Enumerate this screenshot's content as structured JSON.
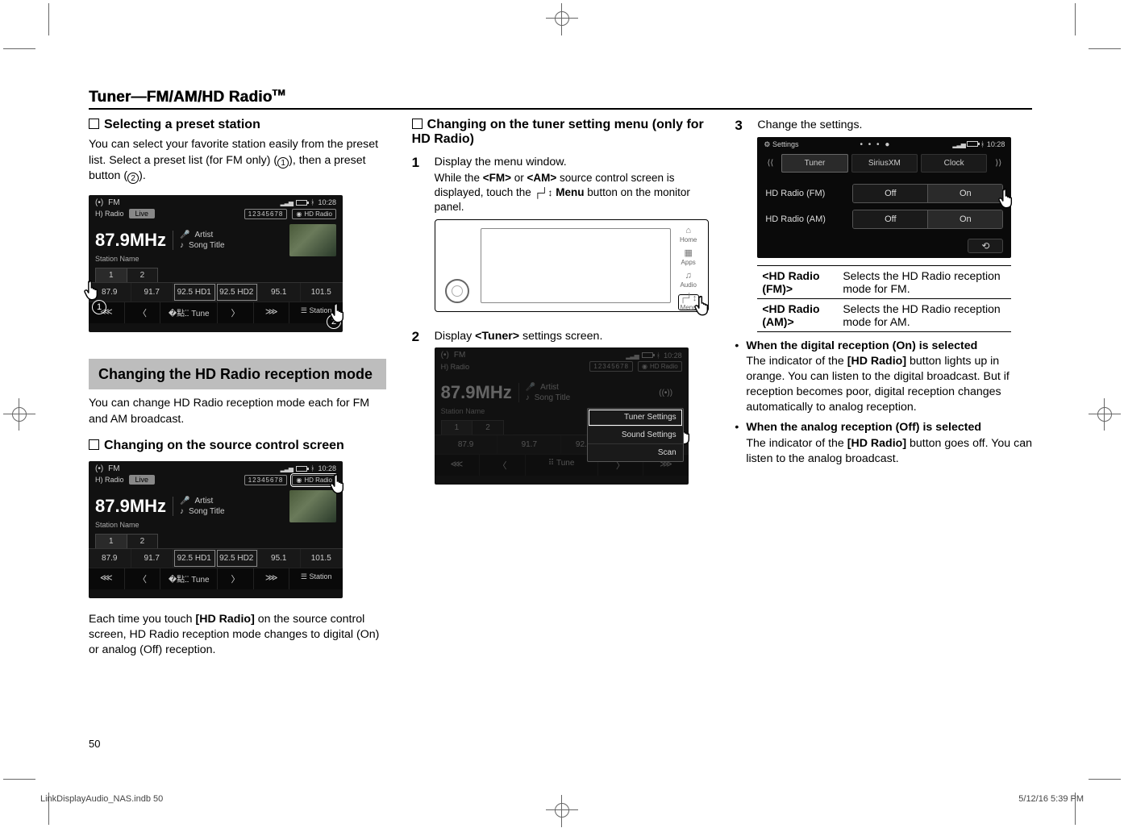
{
  "section_title_prefix": "Tuner—FM/AM/HD Radio",
  "section_title_suffix": "TM",
  "col1": {
    "h_preset": "Selecting a preset station",
    "p_preset_1": "You can select your favorite station easily from the preset list. Select a preset list (for FM only) (",
    "p_preset_circ1": "1",
    "p_preset_mid": "), then a preset button (",
    "p_preset_circ2": "2",
    "p_preset_end": ").",
    "graybox": "Changing the HD Radio reception mode",
    "p_change": "You can change HD Radio reception mode each for FM and AM broadcast.",
    "h_source": "Changing on the source control screen",
    "p_source": "Each time you touch [HD Radio] on the source control screen, HD Radio reception mode changes to digital (On) or analog (Off) reception.",
    "p_source_pre": "Each time you touch ",
    "p_source_bold": "[HD Radio]",
    "p_source_post": " on the source control screen, HD Radio reception mode changes to digital (On) or analog (Off) reception."
  },
  "col2": {
    "h_tuner": "Changing on the tuner setting menu (only for HD Radio)",
    "step1_title": "Display the menu window.",
    "step1_body_pre": "While the ",
    "step1_fm": "<FM>",
    "step1_mid1": " or ",
    "step1_am": "<AM>",
    "step1_mid2": " source control screen is displayed, touch the ",
    "step1_menu": "Menu",
    "step1_post": " button on the monitor panel.",
    "step2_pre": "Display ",
    "step2_bold": "<Tuner>",
    "step2_post": " settings screen.",
    "panel": {
      "home": "Home",
      "apps": "Apps",
      "audio": "Audio",
      "menu": "Menu"
    },
    "popup": {
      "tuner": "Tuner Settings",
      "sound": "Sound Settings",
      "scan": "Scan"
    }
  },
  "col3": {
    "step3": "Change the settings.",
    "settings": {
      "title": "Settings",
      "tabs": {
        "tuner": "Tuner",
        "sirius": "SiriusXM",
        "clock": "Clock"
      },
      "rows": [
        {
          "label": "HD Radio (FM)",
          "off": "Off",
          "on": "On"
        },
        {
          "label": "HD Radio (AM)",
          "off": "Off",
          "on": "On"
        }
      ],
      "time": "10:28"
    },
    "table": [
      {
        "k": "<HD Radio (FM)>",
        "v": "Selects the HD Radio reception mode for FM."
      },
      {
        "k": "<HD Radio (AM)>",
        "v": "Selects the HD Radio reception mode for AM."
      }
    ],
    "bul1_bold": "When the digital reception (On) is selected",
    "bul1_body_pre": "The indicator of the ",
    "bul1_body_bold": "[HD Radio]",
    "bul1_body_post": " button lights up in orange. You can listen to the digital broadcast. But if reception becomes poor, digital reception changes automatically to analog reception.",
    "bul2_bold": "When the analog reception (Off) is selected",
    "bul2_body_pre": "The indicator of the ",
    "bul2_body_bold": "[HD Radio]",
    "bul2_body_post": " button goes off. You can listen to the analog broadcast."
  },
  "radio": {
    "band": "FM",
    "hd_label": "Radio",
    "live": "Live",
    "preset_indicator": "12345678",
    "hd_btn": "HD Radio",
    "freq": "87.9",
    "unit": "MHz",
    "artist": "Artist",
    "song": "Song Title",
    "station": "Station Name",
    "tab1": "1",
    "tab2": "2",
    "presets": [
      "87.9",
      "91.7",
      "92.5 HD1",
      "92.5 HD2",
      "95.1",
      "101.5"
    ],
    "seek_first": "⋘",
    "prev": "〈",
    "tune": "Tune",
    "next": "〉",
    "seek_last": "⋙",
    "station_btn": "Station",
    "time": "10:28"
  },
  "page_number": "50",
  "footer_left": "LinkDisplayAudio_NAS.indb   50",
  "footer_right": "5/12/16   5:39 PM"
}
